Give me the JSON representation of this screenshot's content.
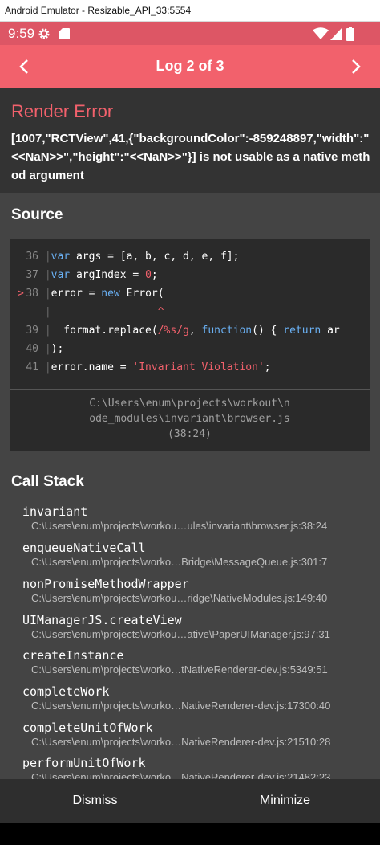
{
  "window": {
    "title": "Android Emulator - Resizable_API_33:5554"
  },
  "status_bar": {
    "time": "9:59",
    "icons": [
      "gear-icon",
      "sd-card-icon",
      "wifi-icon",
      "signal-icon",
      "battery-icon"
    ]
  },
  "header": {
    "title": "Log 2 of 3",
    "prev_icon": "chevron-left-icon",
    "next_icon": "chevron-right-icon"
  },
  "error": {
    "title": "Render Error",
    "message": "[1007,\"RCTView\",41,{\"backgroundColor\":-859248897,\"width\":\"<<NaN>>\",\"height\":\"<<NaN>>\"}] is not usable as a native method argument"
  },
  "source": {
    "heading": "Source",
    "highlight_marker": ">",
    "file": "C:\\Users\\enum\\projects\\workout\\node_modules\\invariant\\browser.js (38:24)",
    "file_lines": [
      "C:\\Users\\enum\\projects\\workout\\n",
      "ode_modules\\invariant\\browser.js",
      "(38:24)"
    ],
    "lines": [
      {
        "number": "36",
        "text": "var args = [a, b, c, d, e, f];"
      },
      {
        "number": "37",
        "text": "var argIndex = 0;"
      },
      {
        "number": "38",
        "text": "error = new Error("
      },
      {
        "number": "",
        "text": "^"
      },
      {
        "number": "39",
        "text": "  format.replace(/%s/g, function() { return ar"
      },
      {
        "number": "40",
        "text": ");"
      },
      {
        "number": "41",
        "text": "error.name = 'Invariant Violation';"
      }
    ]
  },
  "call_stack": {
    "heading": "Call Stack",
    "frames": [
      {
        "method": "invariant",
        "file": "C:\\Users\\enum\\projects\\workou…ules\\invariant\\browser.js:38:24"
      },
      {
        "method": "enqueueNativeCall",
        "file": "C:\\Users\\enum\\projects\\worko…Bridge\\MessageQueue.js:301:7"
      },
      {
        "method": "nonPromiseMethodWrapper",
        "file": "C:\\Users\\enum\\projects\\workou…ridge\\NativeModules.js:149:40"
      },
      {
        "method": "UIManagerJS.createView",
        "file": "C:\\Users\\enum\\projects\\workou…ative\\PaperUIManager.js:97:31"
      },
      {
        "method": "createInstance",
        "file": "C:\\Users\\enum\\projects\\worko…tNativeRenderer-dev.js:5349:51"
      },
      {
        "method": "completeWork",
        "file": "C:\\Users\\enum\\projects\\worko…NativeRenderer-dev.js:17300:40"
      },
      {
        "method": "completeUnitOfWork",
        "file": "C:\\Users\\enum\\projects\\worko…NativeRenderer-dev.js:21510:28"
      },
      {
        "method": "performUnitOfWork",
        "file": "C:\\Users\\enum\\projects\\worko…NativeRenderer-dev.js:21482:23"
      }
    ]
  },
  "footer": {
    "dismiss_label": "Dismiss",
    "minimize_label": "Minimize"
  },
  "colors": {
    "accent": "#f2616c",
    "status_bar": "#dd5665",
    "error_bg": "#333333",
    "body_bg": "#444444",
    "code_bg": "#2a2a2a",
    "footer_bg": "#2e2e2e"
  }
}
